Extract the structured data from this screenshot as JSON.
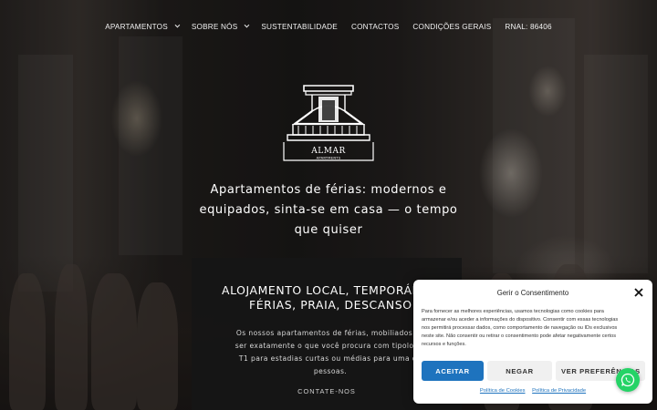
{
  "nav": {
    "items": [
      {
        "label": "APARTAMENTOS",
        "has_dropdown": true
      },
      {
        "label": "SOBRE NÓS",
        "has_dropdown": true
      },
      {
        "label": "SUSTENTABILIDADE",
        "has_dropdown": false
      },
      {
        "label": "CONTACTOS",
        "has_dropdown": false
      },
      {
        "label": "CONDIÇÕES GERAIS",
        "has_dropdown": false
      },
      {
        "label": "RNAL: 86406",
        "has_dropdown": false
      }
    ]
  },
  "logo": {
    "text": "ALMAR",
    "subtext": "APARTMENTS"
  },
  "hero": {
    "tagline_lines": [
      "Apartamentos de férias: modernos e",
      "equipados, sinta-se em casa — o tempo",
      "que quiser"
    ]
  },
  "card": {
    "title_lines": [
      "ALOJAMENTO LOCAL, TEMPORÁR",
      "FÉRIAS, PRAIA, DESCANSO"
    ],
    "text_lines": [
      "Os nossos apartamentos de férias, mobiliados po",
      "ser exatamente o que você procura com tipologia",
      "T1 para estadias curtas ou médias para uma ou",
      "pessoas."
    ],
    "link_label": "CONTATE-NOS"
  },
  "consent": {
    "title": "Gerir o Consentimento",
    "text_lines": [
      "Para fornecer as melhores experiências, usamos tecnologias como cookies para",
      "armazenar e/ou aceder a informações do dispositivo. Consentir com essas tecnologias",
      "nos permitirá processar dados, como comportamento de navegação ou IDs exclusivos",
      "neste site. Não consentir ou retirar o consentimento pode afetar negativamente certos",
      "recursos e funções."
    ],
    "accept_label": "ACEITAR",
    "deny_label": "NEGAR",
    "prefs_label": "VER PREFERÊNCIAS",
    "links": [
      "Política de Cookies",
      "Política de Privacidade"
    ],
    "accent_color": "#1e73be"
  },
  "whatsapp": {
    "icon": "whatsapp-icon",
    "color": "#25d366"
  }
}
